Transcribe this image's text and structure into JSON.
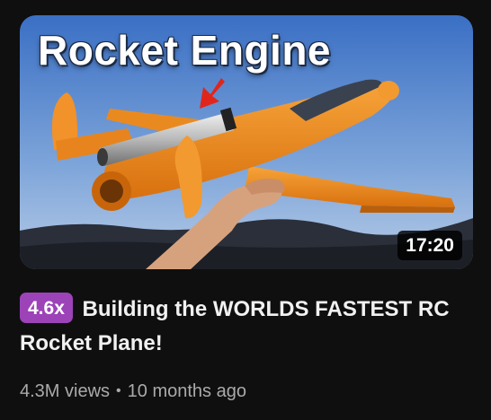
{
  "video": {
    "thumbnail": {
      "overlay_text": "Rocket Engine",
      "duration": "17:20",
      "colors": {
        "sky_top": "#3f73c6",
        "sky_bottom": "#a9c3e5",
        "plane": "#f08a1c",
        "arrow": "#e0261b"
      }
    },
    "speed_badge": "4.6x",
    "title": "Building the WORLDS FASTEST RC Rocket Plane!",
    "views": "4.3M views",
    "separator": "•",
    "age": "10 months ago"
  }
}
